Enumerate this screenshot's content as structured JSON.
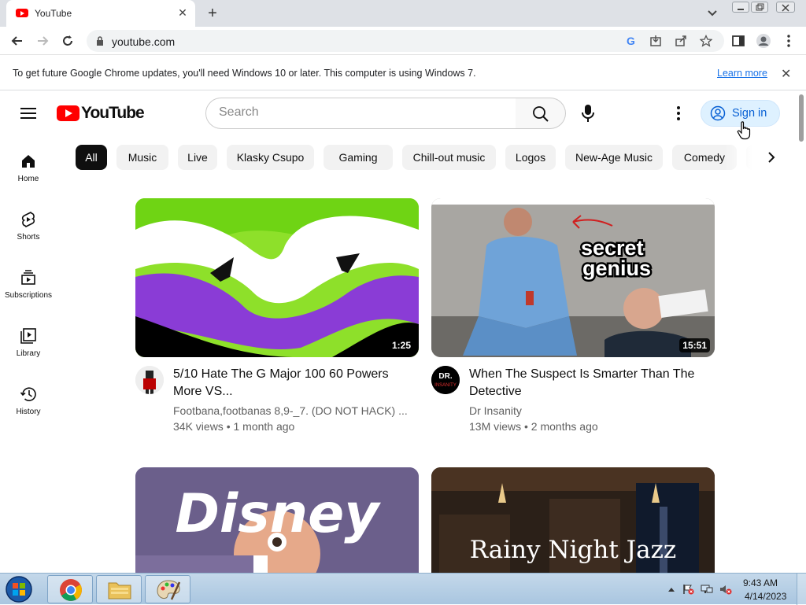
{
  "browser": {
    "tab_title": "YouTube",
    "url": "youtube.com",
    "infobar_text": "To get future Google Chrome updates, you'll need Windows 10 or later. This computer is using Windows 7.",
    "infobar_link": "Learn more"
  },
  "youtube": {
    "logo_text": "YouTube",
    "search_placeholder": "Search",
    "signin_label": "Sign in",
    "chips": [
      "All",
      "Music",
      "Live",
      "Klasky Csupo",
      "Gaming",
      "Chill-out music",
      "Logos",
      "New-Age Music",
      "Comedy"
    ],
    "active_chip": "All",
    "nav": [
      {
        "label": "Home",
        "icon": "home-icon"
      },
      {
        "label": "Shorts",
        "icon": "shorts-icon"
      },
      {
        "label": "Subscriptions",
        "icon": "subscriptions-icon"
      },
      {
        "label": "Library",
        "icon": "library-icon"
      },
      {
        "label": "History",
        "icon": "history-icon"
      }
    ],
    "videos": [
      {
        "title": "5/10 Hate The G Major 100 60 Powers More VS...",
        "channel": "Footbana,footbanas 8,9-_7. (DO NOT HACK) ...",
        "meta": "34K views • 1 month ago",
        "duration": "1:25"
      },
      {
        "title": "When The Suspect Is Smarter Than The Detective",
        "channel": "Dr Insanity",
        "meta": "13M views • 2 months ago",
        "duration": "15:51",
        "thumb_text_1": "secret",
        "thumb_text_2": "genius",
        "avatar_text_1": "DR.",
        "avatar_text_2": "INSANITY"
      },
      {
        "thumb_text": "Disney"
      },
      {
        "thumb_text": "Rainy Night Jazz"
      }
    ]
  },
  "taskbar": {
    "time": "9:43 AM",
    "date": "4/14/2023"
  },
  "colors": {
    "youtube_red": "#ff0000",
    "signin_blue": "#065fd4",
    "chrome_link": "#1a73e8"
  }
}
